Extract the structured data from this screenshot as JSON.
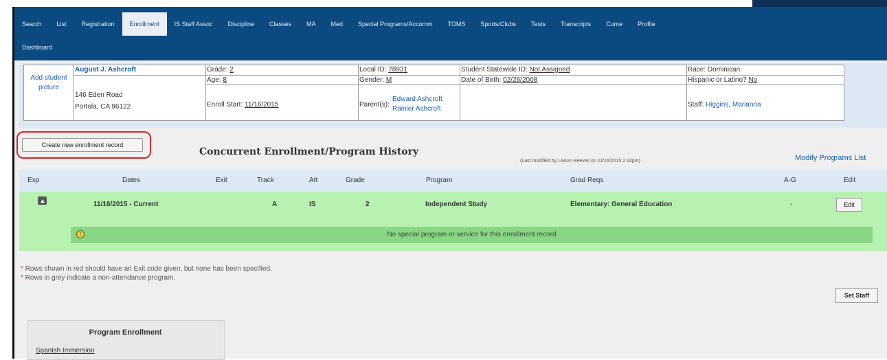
{
  "nav": {
    "row1": [
      "Search",
      "List",
      "Registration",
      "Enrollment",
      "IS Staff Assoc",
      "Discipline",
      "Classes",
      "MA",
      "Med",
      "Special Programs/Accomm",
      "TOMS",
      "Sports/Clubs",
      "Tests",
      "Transcripts",
      "Cume",
      "Profile"
    ],
    "row2": [
      "Dashboard"
    ],
    "active": "Enrollment"
  },
  "student": {
    "add_picture": "Add student picture",
    "name": "August J. Ashcroft",
    "address1": "146 Eden Road",
    "address2": "Portola, CA 96122",
    "grade_label": "Grade:",
    "grade": "2",
    "age_label": "Age:",
    "age": "8",
    "enroll_label": "Enroll Start:",
    "enroll_start": "11/16/2015",
    "local_id_label": "Local ID:",
    "local_id": "78931",
    "gender_label": "Gender:",
    "gender": "M",
    "parents_label": "Parent(s):",
    "parent1": "Edward Ashcroft",
    "parent2": "Rainier Ashcroft",
    "ssid_label": "Student Statewide ID:",
    "ssid": "Not Assigned",
    "dob_label": "Date of Birth:",
    "dob": "02/26/2008",
    "race": "Race: Dominican",
    "hispanic_label": "Hispanic or Latino?",
    "hispanic": "No",
    "staff_label": "Staff:",
    "staff": "Higgins, Marianna"
  },
  "toolbar": {
    "create_button": "Create new enrollment record",
    "section_title": "Concurrent Enrollment/Program History",
    "last_modified": "(Last modified by LeAnn Reeves on 11/16/2015 2:32pm)",
    "modify_link": "Modify Programs List"
  },
  "table": {
    "headers": [
      "Exp",
      "Dates",
      "Exit",
      "Track",
      "Att",
      "Grade",
      "Program",
      "Grad Reqs",
      "A-G",
      "Edit"
    ],
    "rows": [
      {
        "dates": "11/16/2015 - Current",
        "exit": "",
        "track": "A",
        "att": "IS",
        "grade": "2",
        "program": "Independent Study",
        "grad_reqs": "Elementary: General Education",
        "ag": "-",
        "edit": "Edit",
        "note": "No special program or service for this enrollment record"
      }
    ]
  },
  "notes": {
    "star": "*",
    "red_rows": "Rows shown in red should have an Exit code given, but none has been specified.",
    "grey_rows": "Rows in grey indicate a non-attendance program."
  },
  "set_staff": "Set Staff",
  "program_enrollment": {
    "title": "Program Enrollment",
    "items": [
      "Spanish Immersion"
    ]
  },
  "colors": {
    "nav_bg": "#0b4a80",
    "active_row": "#b8f2b0",
    "sub_row": "#89d784",
    "highlight": "#d9262c",
    "link": "#1a5fb4"
  }
}
